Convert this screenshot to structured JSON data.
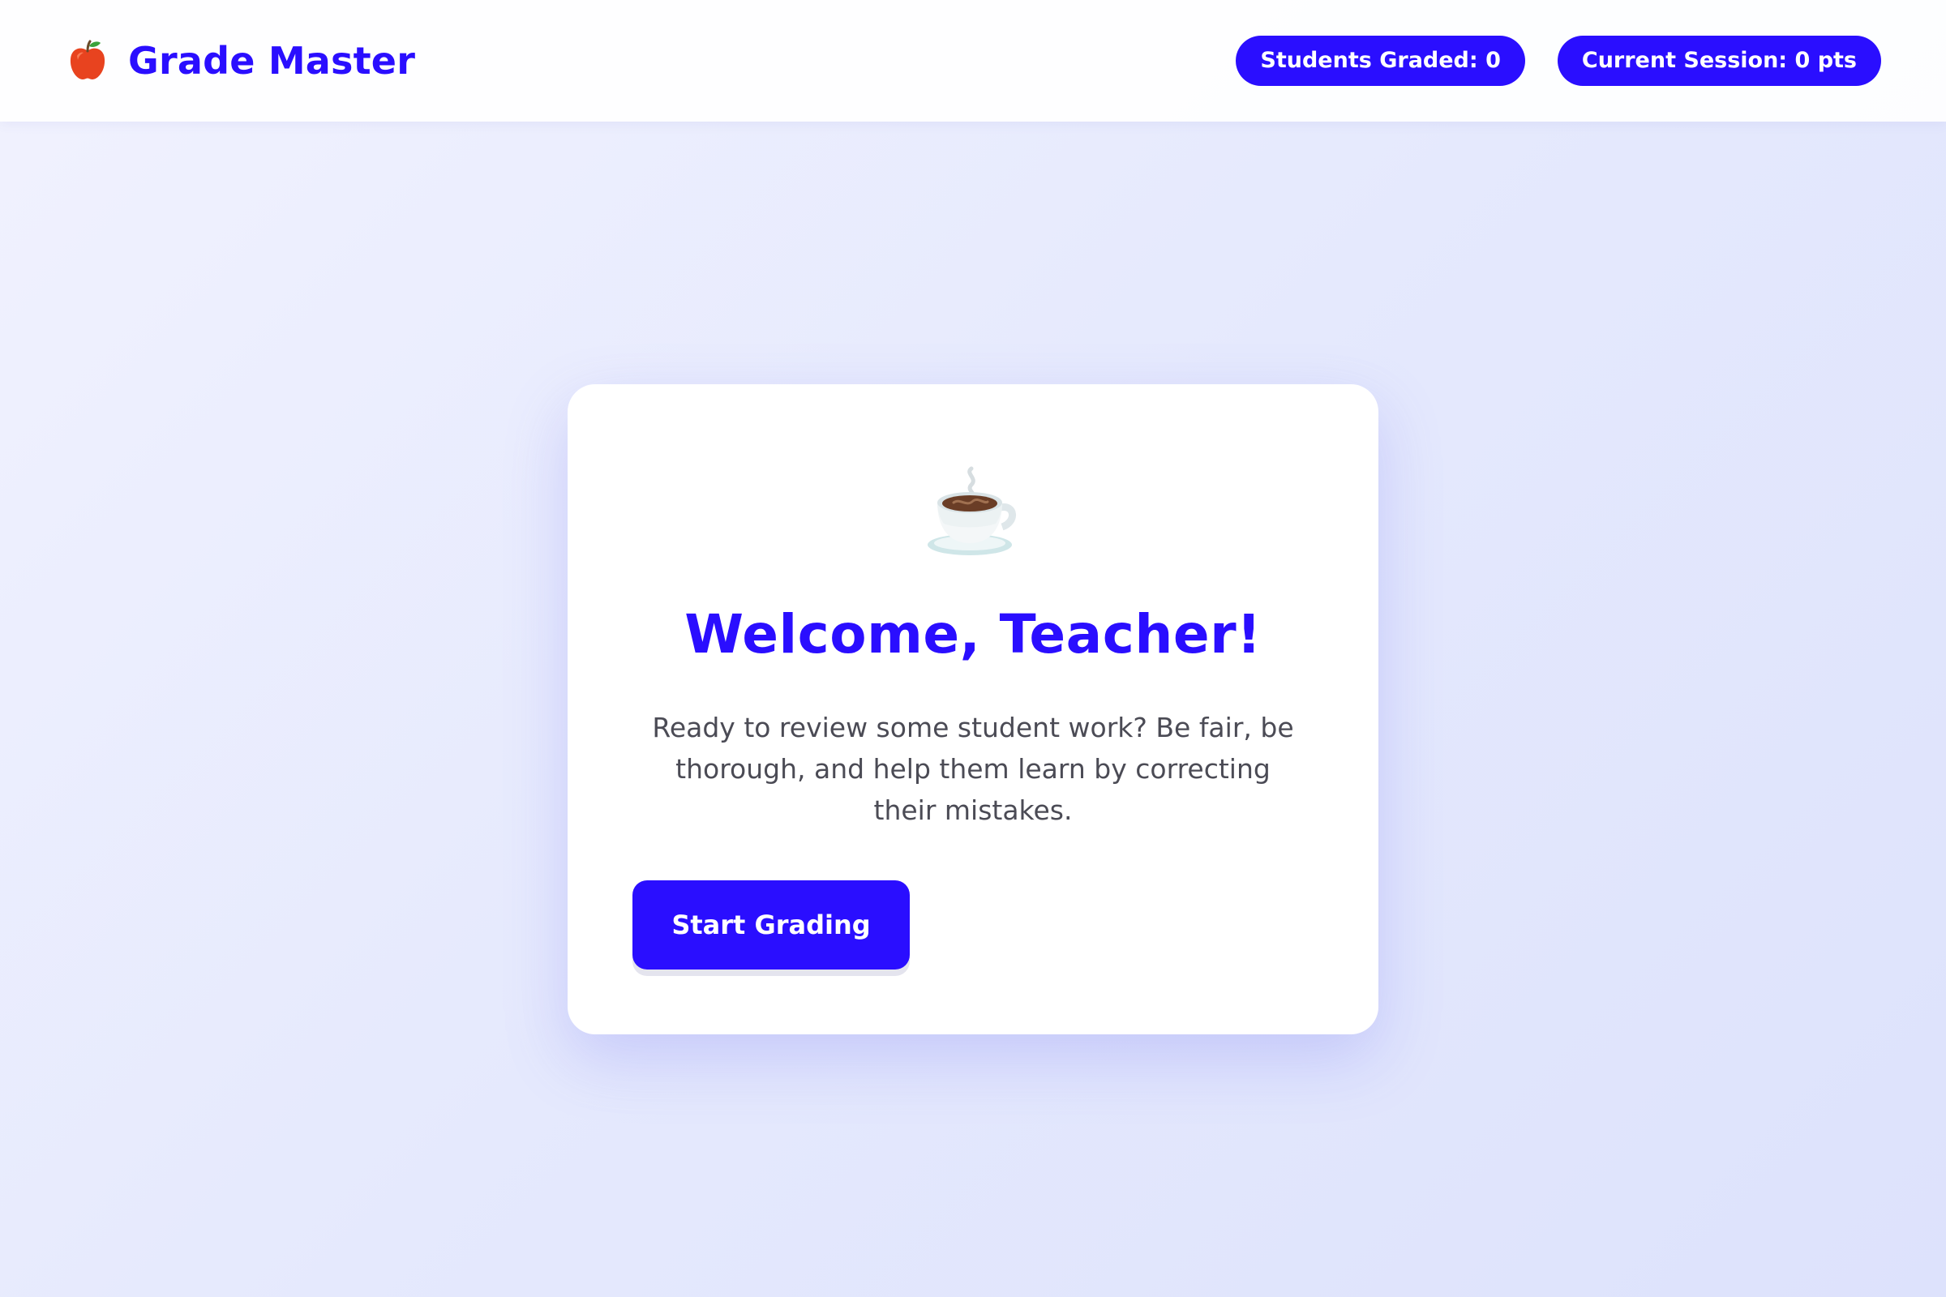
{
  "app": {
    "title": "Grade Master",
    "logo_icon": "red-apple-icon"
  },
  "stats": {
    "students_graded": "Students Graded: 0",
    "current_session": "Current Session: 0 pts"
  },
  "welcome": {
    "icon": "hot-coffee-icon",
    "title": "Welcome, Teacher!",
    "message": "Ready to review some student work? Be fair, be thorough, and help them learn by correcting their mistakes.",
    "button_label": "Start Grading"
  },
  "colors": {
    "accent": "#2a0eff",
    "text_muted": "#4b4b55",
    "card_background": "#ffffff"
  }
}
